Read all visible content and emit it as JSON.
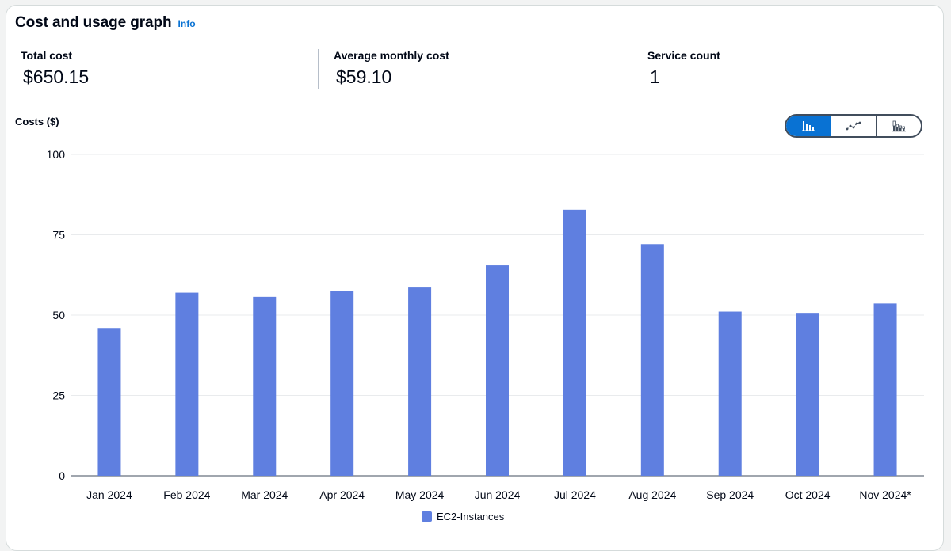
{
  "panel": {
    "title": "Cost and usage graph",
    "info_label": "Info"
  },
  "kpis": [
    {
      "label": "Total cost",
      "value": "$650.15"
    },
    {
      "label": "Average monthly cost",
      "value": "$59.10"
    },
    {
      "label": "Service count",
      "value": "1"
    }
  ],
  "view_toggle": {
    "options": [
      "bar-chart-icon",
      "line-chart-icon",
      "stacked-bar-chart-icon"
    ],
    "selected": "bar-chart-icon"
  },
  "colors": {
    "bar": "#5f7fe0",
    "accent": "#0972d3"
  },
  "chart_data": {
    "type": "bar",
    "ylabel": "Costs ($)",
    "ylim": [
      0,
      100
    ],
    "yticks": [
      0,
      25,
      50,
      75,
      100
    ],
    "grid": true,
    "legend_placement": "bottom-center",
    "categories": [
      "Jan 2024",
      "Feb 2024",
      "Mar 2024",
      "Apr 2024",
      "May 2024",
      "Jun 2024",
      "Jul 2024",
      "Aug 2024",
      "Sep 2024",
      "Oct 2024",
      "Nov 2024*"
    ],
    "series": [
      {
        "name": "EC2-Instances",
        "values": [
          46,
          57,
          55.7,
          57.5,
          58.6,
          65.5,
          82.8,
          72.1,
          51.1,
          50.7,
          53.6
        ]
      }
    ]
  }
}
